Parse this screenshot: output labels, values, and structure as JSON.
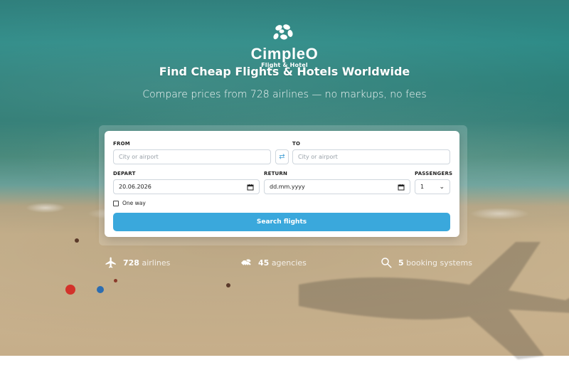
{
  "hero": {
    "logo_text": "CimpleO",
    "logo_subtext": "Flight & Hotel",
    "title": "Find Cheap Flights & Hotels Worldwide",
    "subtitle": "Compare prices from 728 airlines — no markups, no fees"
  },
  "search_form": {
    "from_label": "FROM",
    "from_placeholder": "City or airport",
    "to_label": "TO",
    "to_placeholder": "City or airport",
    "swap_icon": "swap-icon",
    "depart_label": "DEPART",
    "depart_value": "20.06.2026",
    "return_label": "RETURN",
    "return_value": "dd.mm.yyyy",
    "passengers_label": "PASSENGERS",
    "passengers_value": "1",
    "one_way_label": "One way",
    "search_button_label": "Search flights"
  },
  "stats": [
    {
      "icon": "airplane-icon",
      "value": "728",
      "label": "airlines"
    },
    {
      "icon": "handshake-icon",
      "value": "45",
      "label": "agencies"
    },
    {
      "icon": "search-icon",
      "value": "5",
      "label": "booking systems"
    }
  ],
  "colors": {
    "primary_button": "#3aa8dc",
    "panel_bg": "#ffffff"
  }
}
